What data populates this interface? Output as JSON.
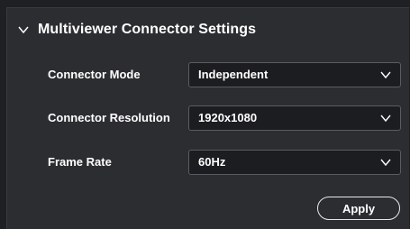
{
  "section": {
    "title": "Multiviewer Connector Settings",
    "expanded": true
  },
  "fields": [
    {
      "label": "Connector Mode",
      "value": "Independent"
    },
    {
      "label": "Connector Resolution",
      "value": "1920x1080"
    },
    {
      "label": "Frame Rate",
      "value": "60Hz"
    }
  ],
  "actions": {
    "apply_label": "Apply"
  },
  "icons": {
    "section_toggle": "chevron-down-icon",
    "dropdown": "chevron-down-icon"
  },
  "colors": {
    "background": "#1f2023",
    "panel": "#2c2d31",
    "select_bg": "#1c1d20",
    "select_border": "#5b5c62",
    "text": "#ffffff"
  }
}
